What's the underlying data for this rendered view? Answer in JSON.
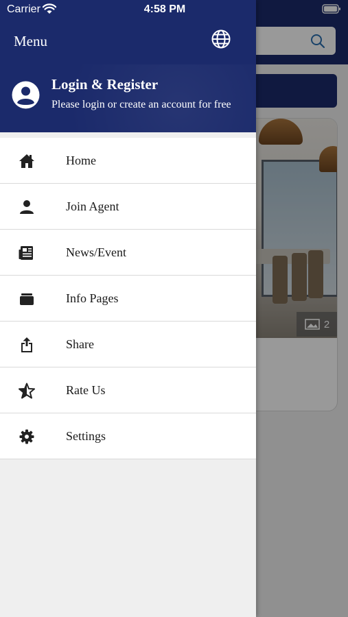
{
  "status_bar": {
    "carrier": "Carrier",
    "time": "4:58 PM"
  },
  "drawer": {
    "title": "Menu",
    "language_icon": "globe-icon",
    "profile": {
      "title": "Login & Register",
      "subtitle": "Please login or create an account for free",
      "icon": "user-circle-icon"
    },
    "items": [
      {
        "label": "Home",
        "icon": "home-icon"
      },
      {
        "label": "Join Agent",
        "icon": "person-icon"
      },
      {
        "label": "News/Event",
        "icon": "newspaper-icon"
      },
      {
        "label": "Info Pages",
        "icon": "archive-icon"
      },
      {
        "label": "Share",
        "icon": "share-icon"
      },
      {
        "label": "Rate Us",
        "icon": "star-icon"
      },
      {
        "label": "Settings",
        "icon": "gear-icon"
      }
    ]
  },
  "background": {
    "gallery_count": "2",
    "search_icon": "search-icon"
  },
  "colors": {
    "primary": "#1b2a6b",
    "drawer_bg": "#efefef"
  }
}
